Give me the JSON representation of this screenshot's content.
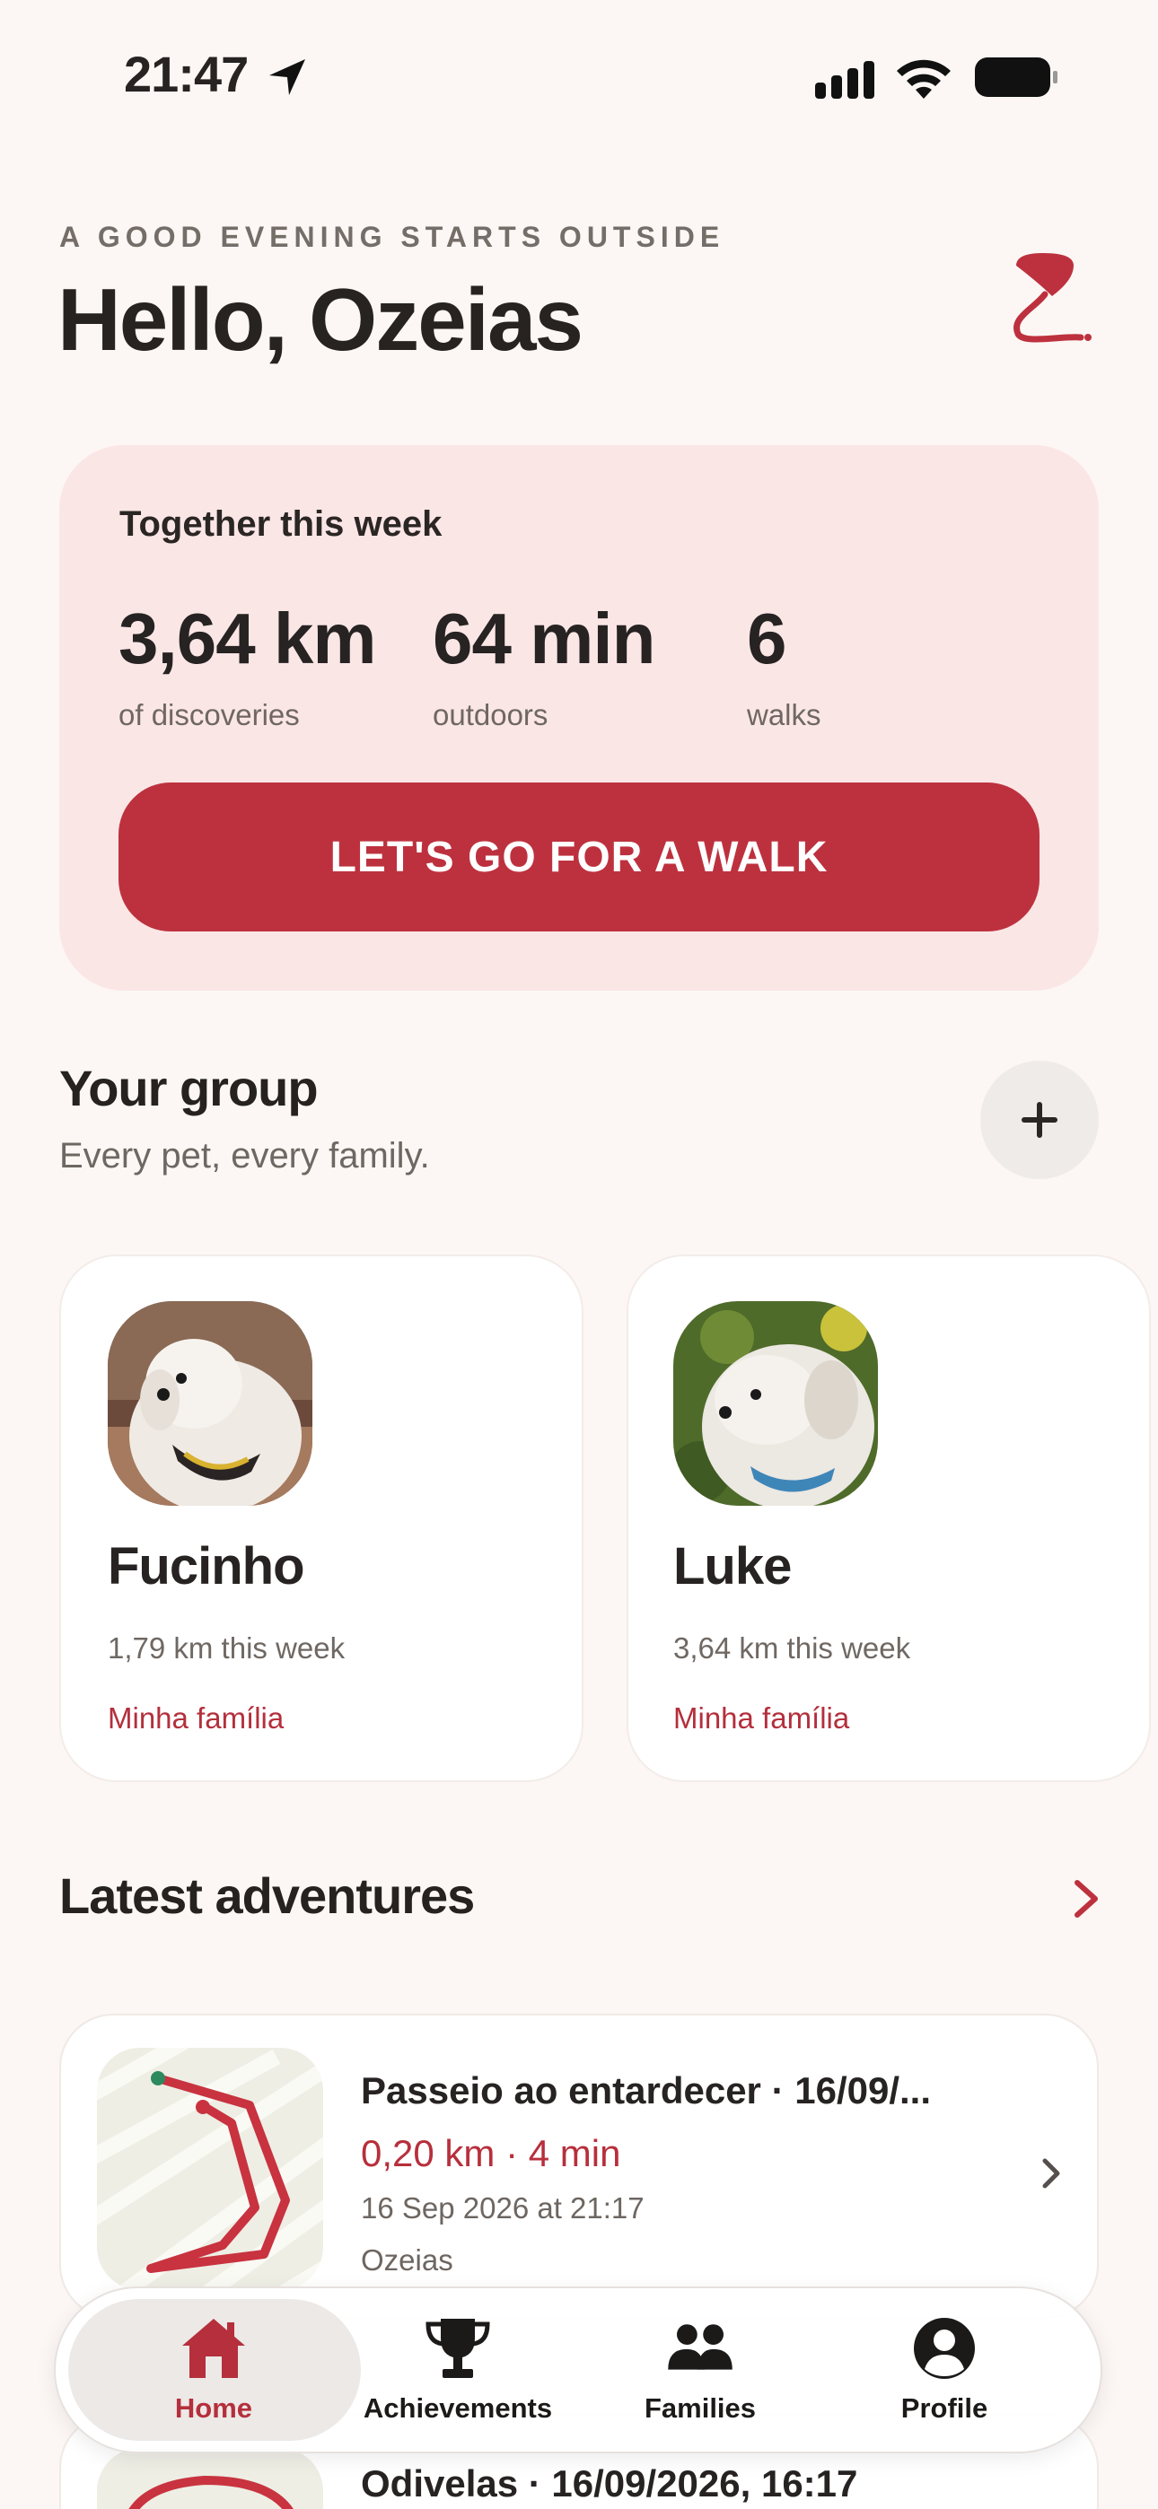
{
  "status_bar": {
    "time": "21:47"
  },
  "header": {
    "kicker": "A GOOD EVENING STARTS OUTSIDE",
    "greeting": "Hello, Ozeias"
  },
  "weekly": {
    "title": "Together this week",
    "stats": [
      {
        "value": "3,64 km",
        "label": "of discoveries"
      },
      {
        "value": "64 min",
        "label": "outdoors"
      },
      {
        "value": "6",
        "label": "walks"
      }
    ],
    "cta_label": "LET'S GO FOR A WALK"
  },
  "group": {
    "title": "Your group",
    "subtitle": "Every pet, every family.",
    "pets": [
      {
        "name": "Fucinho",
        "distance": "1,79 km this week",
        "family": "Minha família"
      },
      {
        "name": "Luke",
        "distance": "3,64 km this week",
        "family": "Minha família"
      }
    ]
  },
  "adventures": {
    "title": "Latest adventures",
    "items": [
      {
        "name": "Passeio ao entardecer · 16/09/...",
        "stats": "0,20 km · 4 min",
        "date": "16 Sep 2026 at 21:17",
        "owner": "Ozeias"
      },
      {
        "name": "Odivelas · 16/09/2026, 16:17"
      }
    ]
  },
  "tabbar": {
    "tabs": [
      {
        "label": "Home",
        "icon": "home-icon",
        "active": true
      },
      {
        "label": "Achievements",
        "icon": "trophy-icon",
        "active": false
      },
      {
        "label": "Families",
        "icon": "people-icon",
        "active": false
      },
      {
        "label": "Profile",
        "icon": "profile-icon",
        "active": false
      }
    ]
  },
  "colors": {
    "accent": "#bd313e",
    "card_pink": "#fbe6e6",
    "background": "#fcf7f4"
  }
}
